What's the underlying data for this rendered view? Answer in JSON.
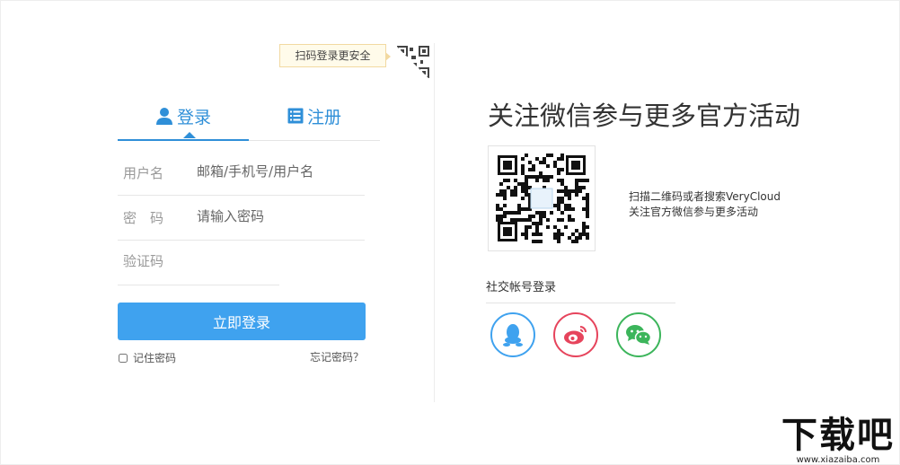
{
  "login": {
    "qr_tip": "扫码登录更安全",
    "tabs": [
      {
        "label": "登录",
        "active": true
      },
      {
        "label": "注册",
        "active": false
      }
    ],
    "fields": {
      "username": {
        "label": "用户名",
        "placeholder": "邮箱/手机号/用户名"
      },
      "password": {
        "label": "密　码",
        "placeholder": "请输入密码"
      },
      "captcha": {
        "placeholder": "验证码"
      }
    },
    "submit_label": "立即登录",
    "remember_label": "记住密码",
    "forgot_label": "忘记密码？"
  },
  "promo": {
    "title": "关注微信参与更多官方活动",
    "qr_desc_line1": "扫描二维码或者搜索VeryCloud",
    "qr_desc_line2": "关注官方微信参与更多活动",
    "social_title": "社交帐号登录",
    "social": [
      {
        "name": "qq",
        "color": "#3fa2ef"
      },
      {
        "name": "weibo",
        "color": "#e6445c"
      },
      {
        "name": "wechat",
        "color": "#3cb55b"
      }
    ]
  },
  "watermark": {
    "main": "下载吧",
    "sub": "www.xiazaiba.com"
  },
  "colors": {
    "accent": "#3fa2ef",
    "tab_blue": "#2f8fd8"
  }
}
